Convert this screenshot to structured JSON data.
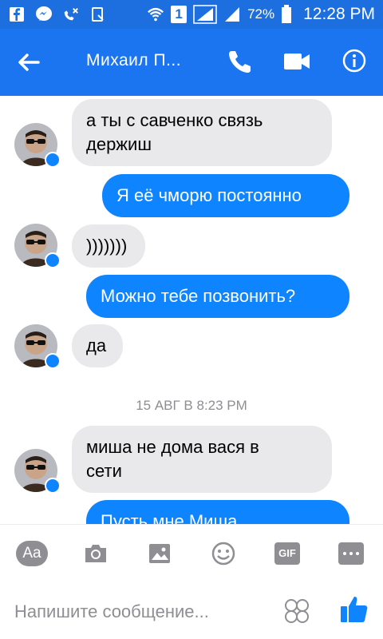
{
  "status_bar": {
    "signal_percent": "72%",
    "sim_slot": "1",
    "time": "12:28 PM"
  },
  "header": {
    "title": "Михаил П..."
  },
  "messages": [
    {
      "direction": "in",
      "text_line1": "а ты  с савченко  связь",
      "text_line2": "держиш"
    },
    {
      "direction": "out",
      "text": "Я её чморю постоянно"
    },
    {
      "direction": "in",
      "text": ")))))))"
    },
    {
      "direction": "out",
      "text": "Можно тебе позвонить?"
    },
    {
      "direction": "in",
      "text": "да"
    },
    {
      "direction": "in",
      "text_line1": "миша не дома вася в",
      "text_line2": "сети"
    },
    {
      "direction": "out",
      "text": "Пусть мне Миша"
    }
  ],
  "timestamp": "15 АВГ В 8:23 PM",
  "composer": {
    "placeholder": "Напишите сообщение...",
    "tools": [
      "text-format-icon",
      "camera-icon",
      "image-icon",
      "emoji-icon",
      "gif-icon",
      "more-icon"
    ],
    "gif_label": "GIF",
    "aa_label": "Aa"
  },
  "colors": {
    "status_bar": "#1d6fe0",
    "app_bar": "#1b74f0",
    "outgoing_bubble": "#0f84ff",
    "incoming_bubble": "#e9e9eb",
    "muted_text": "#8e8e93"
  }
}
